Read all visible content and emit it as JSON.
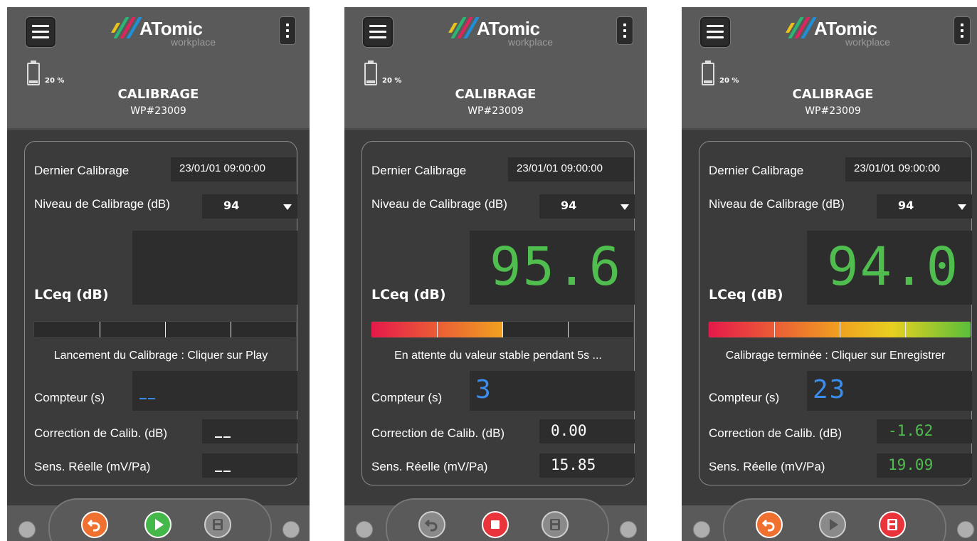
{
  "app": {
    "logo_text": "ATomic",
    "logo_sub": "workplace",
    "battery": "20 %",
    "title": "CALIBRAGE",
    "device_id": "WP#23009"
  },
  "labels": {
    "dernier": "Dernier Calibrage",
    "niveau": "Niveau de Calibrage (dB)",
    "lceq": "LCeq (dB)",
    "compteur": "Compteur (s)",
    "correction": "Correction de Calib. (dB)",
    "sens": "Sens. Réelle (mV/Pa)"
  },
  "screens": [
    {
      "date": "23/01/01  09:00:00",
      "niveau": "94",
      "lceq": "",
      "progress": 0,
      "status": "Lancement du Calibrage : Cliquer sur Play",
      "compteur": "__",
      "correction": "__",
      "sens": "__"
    },
    {
      "date": "23/01/01  09:00:00",
      "niveau": "94",
      "lceq": "95.6",
      "progress": 0.5,
      "status": "En attente du valeur stable pendant 5s ...",
      "compteur": "3",
      "correction": "0.00",
      "sens": "15.85"
    },
    {
      "date": "23/01/01  09:00:00",
      "niveau": "94",
      "lceq": "94.0",
      "progress": 1.0,
      "status": "Calibrage terminée : Cliquer sur Enregistrer",
      "compteur": "23",
      "correction": "-1.62",
      "sens": "19.09"
    }
  ],
  "colors": {
    "accent_green": "#4fbe4f",
    "counter_blue": "#3a8ef0",
    "undo_orange": "#f07030",
    "play_green": "#45b84a",
    "stop_red": "#e8343a",
    "disabled_gray": "#8a8a8a"
  },
  "icons": {
    "undo": "undo-icon",
    "play": "play-icon",
    "stop": "stop-icon",
    "save": "save-icon"
  }
}
